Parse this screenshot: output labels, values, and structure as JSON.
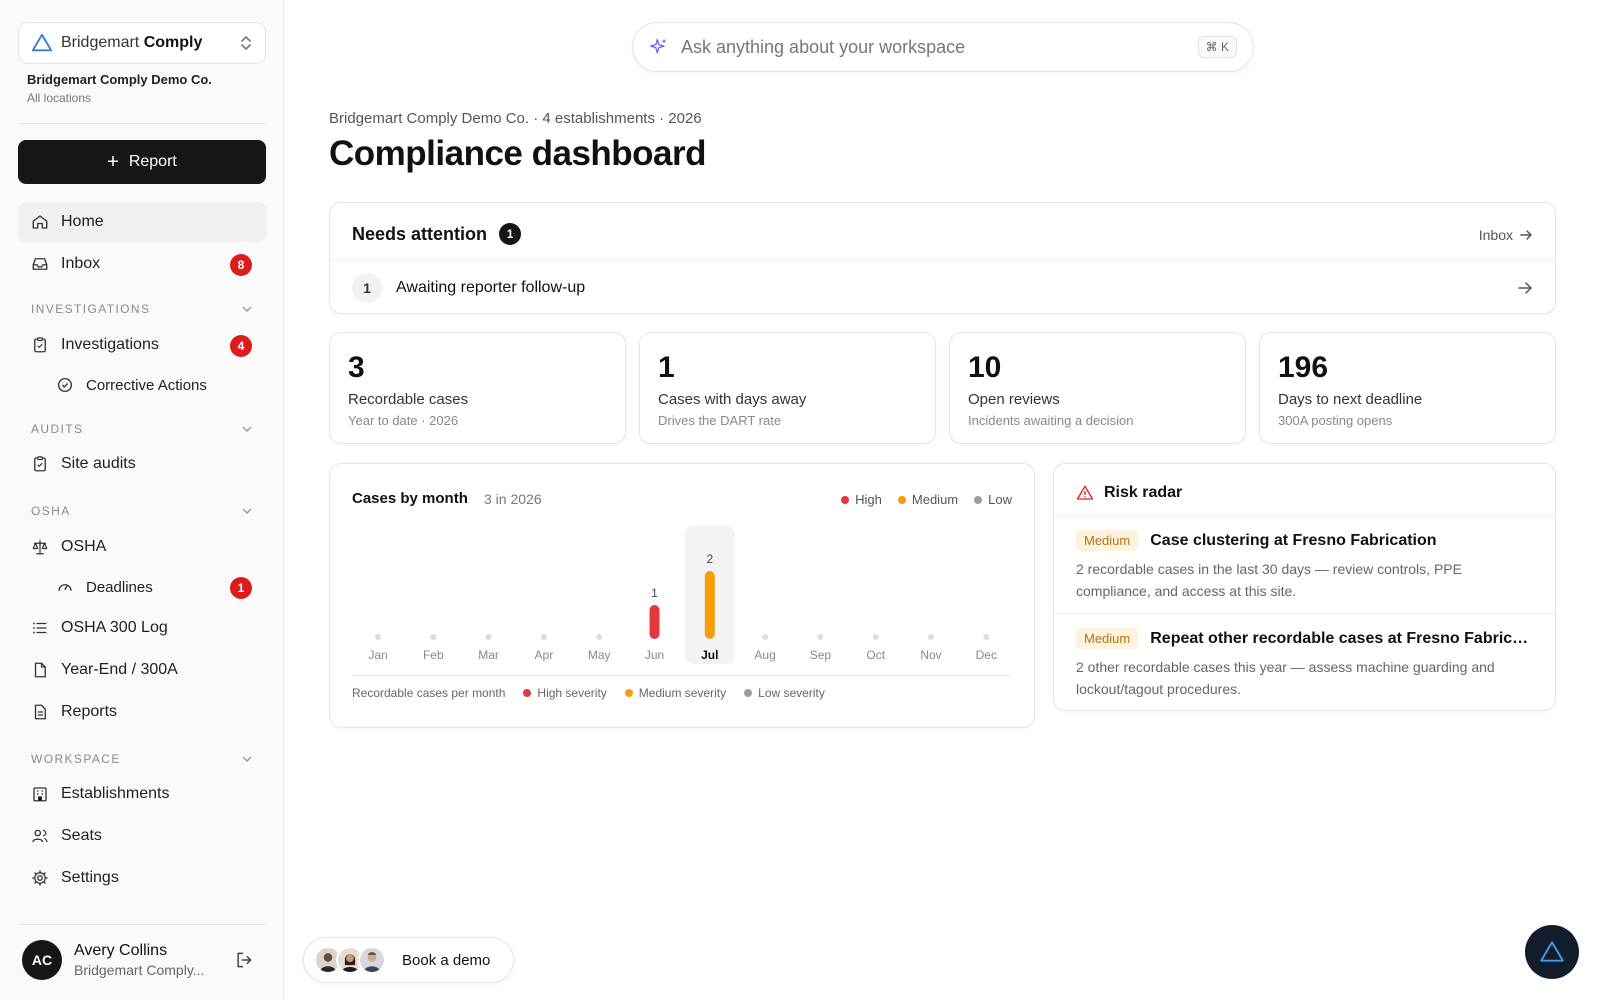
{
  "sidebar": {
    "brand_light": "Bridgemart",
    "brand_bold": "Comply",
    "org_name": "Bridgemart Comply Demo Co.",
    "org_sub": "All locations",
    "report_label": "Report",
    "home": "Home",
    "inbox": "Inbox",
    "inbox_badge": "8",
    "sections": {
      "investigations": "INVESTIGATIONS",
      "audits": "AUDITS",
      "osha": "OSHA",
      "workspace": "WORKSPACE"
    },
    "investigations": "Investigations",
    "investigations_badge": "4",
    "corrective_actions": "Corrective Actions",
    "site_audits": "Site audits",
    "osha": "OSHA",
    "deadlines": "Deadlines",
    "deadlines_badge": "1",
    "osha_300_log": "OSHA 300 Log",
    "year_end": "Year-End / 300A",
    "reports": "Reports",
    "establishments": "Establishments",
    "seats": "Seats",
    "settings": "Settings",
    "user": {
      "initials": "AC",
      "name": "Avery Collins",
      "org": "Bridgemart Comply..."
    }
  },
  "search": {
    "placeholder": "Ask anything about your workspace",
    "shortcut": "⌘ K"
  },
  "header": {
    "breadcrumb": "Bridgemart Comply Demo Co. · 4 establishments · 2026",
    "title": "Compliance dashboard"
  },
  "attention": {
    "title": "Needs attention",
    "count": "1",
    "inbox_link": "Inbox",
    "items": [
      {
        "num": "1",
        "label": "Awaiting reporter follow-up"
      }
    ]
  },
  "stats": [
    {
      "value": "3",
      "label": "Recordable cases",
      "sub": "Year to date · 2026"
    },
    {
      "value": "1",
      "label": "Cases with days away",
      "sub": "Drives the DART rate"
    },
    {
      "value": "10",
      "label": "Open reviews",
      "sub": "Incidents awaiting a decision"
    },
    {
      "value": "196",
      "label": "Days to next deadline",
      "sub": "300A posting opens"
    }
  ],
  "chart": {
    "legend": {
      "high": "High",
      "medium": "Medium",
      "low": "Low"
    },
    "footer": {
      "caption": "Recordable cases per month",
      "high": "High severity",
      "medium": "Medium severity",
      "low": "Low severity"
    }
  },
  "chart_data": {
    "type": "bar",
    "title": "Cases by month",
    "subtitle": "3 in 2026",
    "categories": [
      "Jan",
      "Feb",
      "Mar",
      "Apr",
      "May",
      "Jun",
      "Jul",
      "Aug",
      "Sep",
      "Oct",
      "Nov",
      "Dec"
    ],
    "series": [
      {
        "name": "High",
        "values": [
          0,
          0,
          0,
          0,
          0,
          1,
          0,
          0,
          0,
          0,
          0,
          0
        ]
      },
      {
        "name": "Medium",
        "values": [
          0,
          0,
          0,
          0,
          0,
          0,
          2,
          0,
          0,
          0,
          0,
          0
        ]
      },
      {
        "name": "Low",
        "values": [
          0,
          0,
          0,
          0,
          0,
          0,
          0,
          0,
          0,
          0,
          0,
          0
        ]
      }
    ],
    "totals": [
      0,
      0,
      0,
      0,
      0,
      1,
      2,
      0,
      0,
      0,
      0,
      0
    ],
    "highlighted": "Jul",
    "ylim": [
      0,
      2
    ],
    "colors": {
      "High": "#e5383b",
      "Medium": "#f59e0b",
      "Low": "#9e9e9e"
    },
    "grid": false,
    "legend_position": "top-right"
  },
  "radar": {
    "title": "Risk radar",
    "items": [
      {
        "severity": "Medium",
        "title": "Case clustering at Fresno Fabrication",
        "desc": "2 recordable cases in the last 30 days — review controls, PPE compliance, and access at this site."
      },
      {
        "severity": "Medium",
        "title": "Repeat other recordable cases at Fresno Fabrica...",
        "desc": "2 other recordable cases this year — assess machine guarding and lockout/tagout procedures."
      }
    ]
  },
  "demo": {
    "label": "Book a demo"
  }
}
